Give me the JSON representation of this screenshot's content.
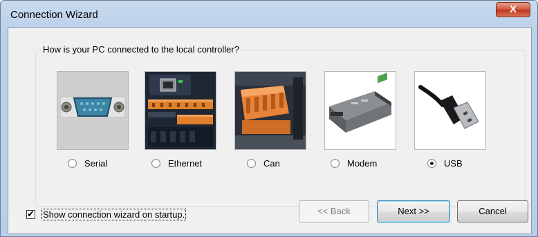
{
  "window": {
    "title": "Connection Wizard",
    "close_label": "X"
  },
  "group": {
    "legend": "How is your PC connected to the local controller?"
  },
  "options": [
    {
      "label": "Serial",
      "selected": false,
      "icon": "serial-port-icon"
    },
    {
      "label": "Ethernet",
      "selected": false,
      "icon": "ethernet-controller-icon"
    },
    {
      "label": "Can",
      "selected": false,
      "icon": "can-connector-icon"
    },
    {
      "label": "Modem",
      "selected": false,
      "icon": "modem-icon"
    },
    {
      "label": "USB",
      "selected": true,
      "icon": "usb-plug-icon"
    }
  ],
  "startup": {
    "checked": true,
    "check_mark": "✔",
    "label": "Show connection wizard on startup."
  },
  "buttons": {
    "back": "<< Back",
    "next": "Next >>",
    "cancel": "Cancel"
  },
  "colors": {
    "title_bar": "#bcd2ea",
    "close_button": "#c9432a",
    "dialog_bg": "#f0f0f0"
  }
}
